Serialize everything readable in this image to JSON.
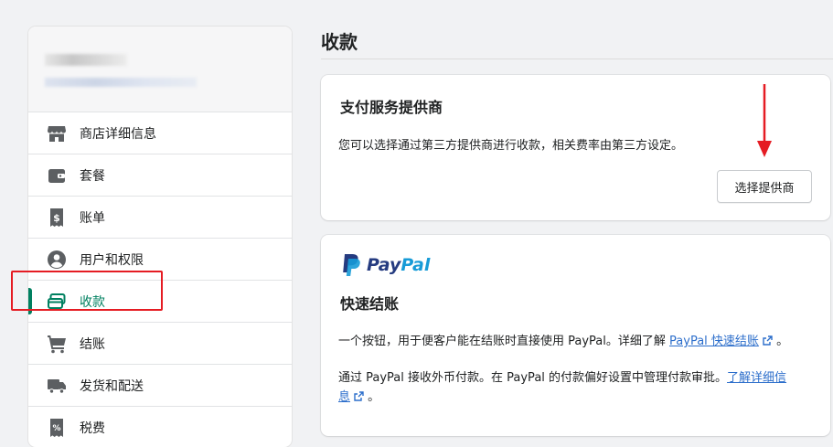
{
  "sidebar": {
    "items": [
      {
        "label": "商店详细信息",
        "icon": "store-icon"
      },
      {
        "label": "套餐",
        "icon": "wallet-icon"
      },
      {
        "label": "账单",
        "icon": "bill-icon"
      },
      {
        "label": "用户和权限",
        "icon": "user-icon"
      },
      {
        "label": "收款",
        "icon": "payments-icon",
        "active": true
      },
      {
        "label": "结账",
        "icon": "cart-icon"
      },
      {
        "label": "发货和配送",
        "icon": "truck-icon"
      },
      {
        "label": "税费",
        "icon": "tax-icon"
      }
    ]
  },
  "page": {
    "title": "收款"
  },
  "providers_card": {
    "heading": "支付服务提供商",
    "description": "您可以选择通过第三方提供商进行收款，相关费率由第三方设定。",
    "button_label": "选择提供商"
  },
  "paypal_card": {
    "brand": "PayPal",
    "brand_part1": "Pay",
    "brand_part2": "Pal",
    "heading": "快速结账",
    "para1_text": "一个按钮，用于便客户能在结账时直接使用 PayPal。详细了解",
    "para1_link": "PayPal 快速结账",
    "para1_end": "。",
    "para2_text": "通过 PayPal 接收外币付款。在 PayPal 的付款偏好设置中管理付款审批。",
    "para2_link_line1": "了解详细信",
    "para2_link_line2": "息",
    "para2_end": "。"
  },
  "colors": {
    "accent": "#008060",
    "annotation_red": "#e51c23",
    "link": "#2c6ecb",
    "paypal_dark": "#253b80",
    "paypal_light": "#179bd7"
  }
}
